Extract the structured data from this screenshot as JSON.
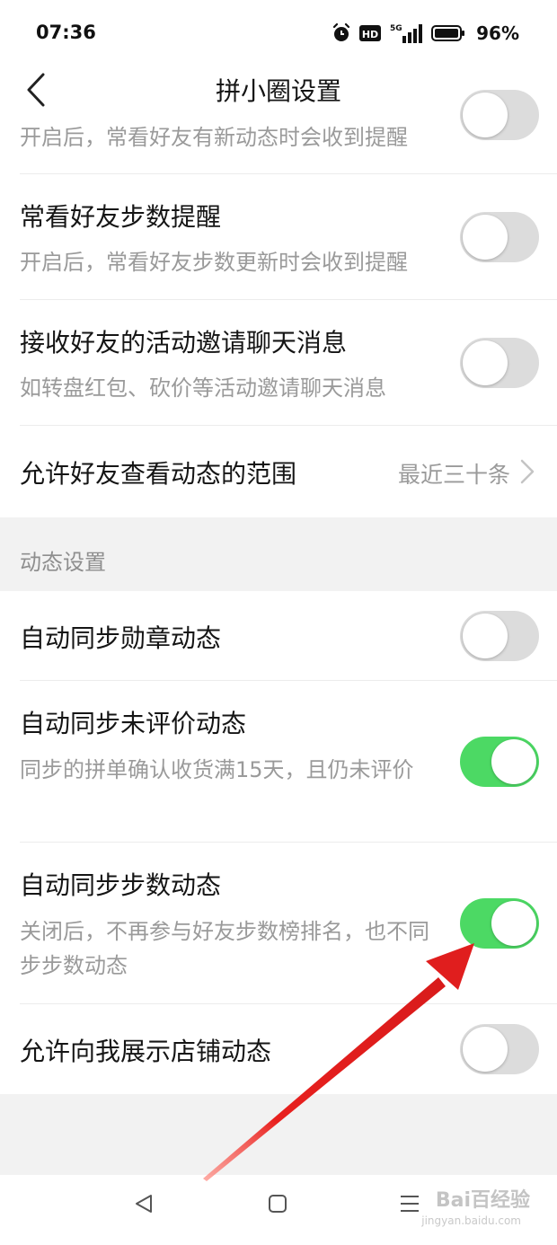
{
  "status_bar": {
    "time": "07:36",
    "hd_label": "HD",
    "network_label": "5G",
    "battery": "96%"
  },
  "header": {
    "title": "拼小圈设置"
  },
  "rows_top": [
    {
      "subtitle": "开启后，常看好友有新动态时会收到提醒",
      "toggle": "off"
    },
    {
      "title": "常看好友步数提醒",
      "subtitle": "开启后，常看好友步数更新时会收到提醒",
      "toggle": "off"
    },
    {
      "title": "接收好友的活动邀请聊天消息",
      "subtitle": "如转盘红包、砍价等活动邀请聊天消息",
      "toggle": "off"
    },
    {
      "title": "允许好友查看动态的范围",
      "value": "最近三十条"
    }
  ],
  "section": {
    "title": "动态设置"
  },
  "rows_dynamic": [
    {
      "title": "自动同步勋章动态",
      "toggle": "off"
    },
    {
      "title": "自动同步未评价动态",
      "subtitle": "同步的拼单确认收货满15天，且仍未评价",
      "toggle": "on"
    },
    {
      "title": "自动同步步数动态",
      "subtitle": "关闭后，不再参与好友步数榜排名，也不同步步数动态",
      "toggle": "on"
    },
    {
      "title": "允许向我展示店铺动态",
      "toggle": "off"
    }
  ],
  "watermark": {
    "text": "Bai百经验",
    "sub": "jingyan.baidu.com"
  },
  "colors": {
    "toggle_on": "#4cd964",
    "toggle_off": "#dcdcdc",
    "annotation_arrow": "#e8201e"
  },
  "icons": {
    "back": "chevron-left-icon",
    "alarm": "alarm-icon",
    "signal": "signal-icon",
    "battery": "battery-icon",
    "row_chevron": "chevron-right-icon",
    "nav_back": "triangle-back-icon",
    "nav_home": "square-home-icon",
    "nav_menu": "menu-lines-icon"
  }
}
